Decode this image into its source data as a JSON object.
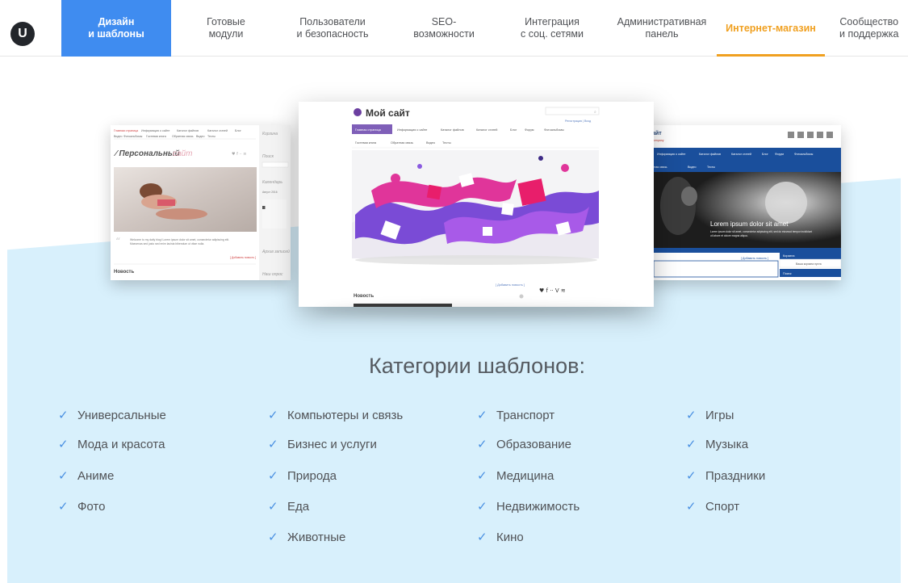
{
  "logo": {
    "letter": "U"
  },
  "nav": [
    {
      "label": "Дизайн\nи шаблоны",
      "state": "active"
    },
    {
      "label": "Готовые\nмодули",
      "state": ""
    },
    {
      "label": "Пользователи\nи безопасность",
      "state": ""
    },
    {
      "label": "SEO-\nвозможности",
      "state": ""
    },
    {
      "label": "Интеграция\nс соц. сетями",
      "state": ""
    },
    {
      "label": "Административная\nпанель",
      "state": ""
    },
    {
      "label": "Интернет-магазин",
      "state": "highlight"
    },
    {
      "label": "Сообщество\nи поддержка",
      "state": ""
    }
  ],
  "preview_left": {
    "site_title": "Персональный",
    "site_title_accent": "сайт",
    "nav_items": [
      "Главная страница",
      "Информация о сайте",
      "Каталог файлов",
      "Каталог статей",
      "Блог",
      "Видео",
      "Фотоальбомы",
      "Гостевая книга",
      "Обратная связь",
      "Тесты"
    ],
    "sidebar_title": "Корзина",
    "sidebar_search": "Поиск",
    "sidebar_calendar": "Календарь",
    "sidebar_month": "Август 2016",
    "sidebar_archive": "Архив записей",
    "sidebar_friends": "Наш опрос",
    "quote": "Welcome to my daily blog! Lorem ipsum dolor sit amet, consectetur adipiscing elit. Maecenas sed justo sed enim lacinia bibendum ut vitae nulla.",
    "add_news": "[ Добавить новость ]",
    "news": "Новость"
  },
  "preview_center": {
    "site_title": "Мой сайт",
    "nav_items": [
      "Главная страница",
      "Информация о сайте",
      "Каталог файлов",
      "Каталог статей",
      "Блог",
      "Форум",
      "Фотоальбомы"
    ],
    "nav_items_2": [
      "Гостевая книга",
      "Обратная связь",
      "Видео",
      "Тесты"
    ],
    "user_links": "Регистрация | Вход",
    "add_news": "[ Добавить новость ]",
    "news": "Новость",
    "social": [
      "twitter",
      "facebook",
      "flickr",
      "vimeo",
      "rss"
    ]
  },
  "preview_right": {
    "site_title": "айт",
    "subtitle": "company",
    "nav_items": [
      "Информация о сайте",
      "Каталог файлов",
      "Каталог статей",
      "Блог",
      "Форум",
      "Фотоальбомы"
    ],
    "nav_items_2": [
      "Обратная связь",
      "Видео",
      "Тесты"
    ],
    "hero_title": "Lorem ipsum dolor sit amet",
    "hero_text": "Lorem ipsum dolor sit amet, consectetur adipiscing elit, sed do eiusmod tempor incididunt ut labore et dolore magna aliqua.",
    "add_news": "[ Добавить новость ]",
    "cart": "Корзина",
    "cart_empty": "Ваша корзина пуста",
    "search": "Поиск"
  },
  "categories_title": "Категории шаблонов:",
  "categories": [
    [
      "Универсальные",
      "Мода и красота",
      "Аниме",
      "Фото"
    ],
    [
      "Компьютеры и связь",
      "Бизнес и услуги",
      "Природа",
      "Еда",
      "Животные"
    ],
    [
      "Транспорт",
      "Образование",
      "Медицина",
      "Недвижимость",
      "Кино"
    ],
    [
      "Игры",
      "Музыка",
      "Праздники",
      "Спорт"
    ]
  ],
  "colors": {
    "accent": "#3f8cf0",
    "shop": "#f0a020",
    "bg_blue": "#d8f0fc",
    "check": "#4a90e2"
  }
}
